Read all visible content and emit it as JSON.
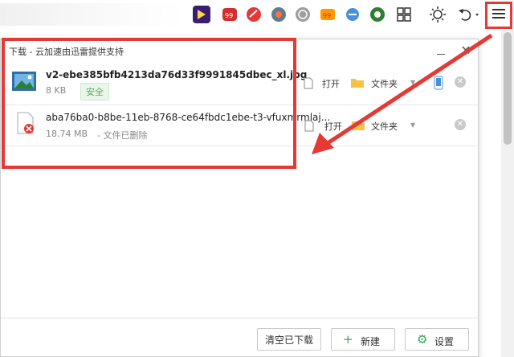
{
  "toolbar": {
    "icons": [
      "video-app-icon",
      "app-badge-icon",
      "red-app-icon",
      "game-app-icon",
      "grey-app-icon",
      "fire-app-icon",
      "minus-circle-icon",
      "green-app-icon",
      "grid-icon",
      "brightness-icon",
      "undo-icon",
      "menu-icon"
    ]
  },
  "panel": {
    "title": "下载 - 云加速由迅雷提供支持"
  },
  "downloads": [
    {
      "name": "v2-ebe385bfb4213da76d33f9991845dbec_xl.jpg",
      "size": "8 KB",
      "badge": "安全",
      "open": "打开",
      "folder": "文件夹"
    },
    {
      "name": "aba76ba0-b8be-11eb-8768-ce64fbdc1ebe-t3-vfuxmrmlaj...",
      "size": "18.74 MB",
      "status": "- 文件已删除",
      "open": "打开",
      "folder": "文件夹"
    }
  ],
  "footer": {
    "clear_label": "清空已下载",
    "new_label": "新建",
    "settings_label": "设置"
  },
  "colors": {
    "highlight_red": "#e53935",
    "safe_green": "#5ba85b",
    "plus_green": "#3aa757"
  }
}
